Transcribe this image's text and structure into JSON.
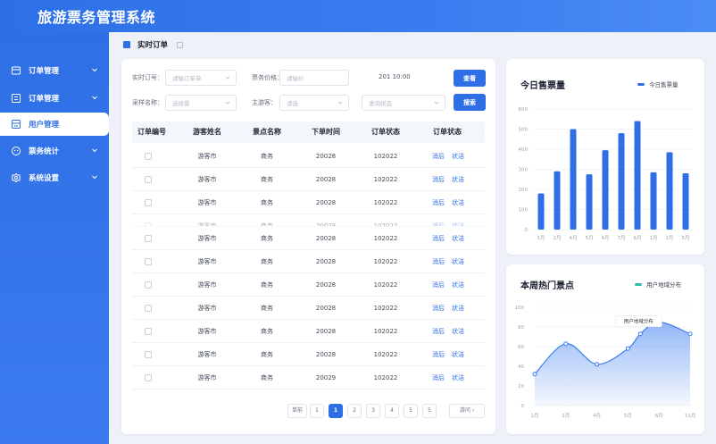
{
  "app": {
    "title": "旅游票务管理系统"
  },
  "sidebar": {
    "items": [
      {
        "label": "订单管理",
        "icon": "order-icon",
        "active": false,
        "has_arrow": true
      },
      {
        "label": "订单管理",
        "icon": "list-icon",
        "active": false,
        "has_arrow": true
      },
      {
        "label": "用户管理",
        "icon": "user-icon",
        "active": true,
        "has_arrow": false
      },
      {
        "label": "票务统计",
        "icon": "chart-icon",
        "active": false,
        "has_arrow": true
      },
      {
        "label": "系统设置",
        "icon": "gear-icon",
        "active": false,
        "has_arrow": true
      }
    ]
  },
  "page": {
    "title": "实时订单"
  },
  "filters": {
    "order_no_label": "实时订号：",
    "order_no_placeholder": "请输订单单",
    "ticket_price_label": "票务价格：",
    "ticket_price_placeholder": "请输价",
    "date_value": "201 10:00",
    "query_button": "查看",
    "scenic_label": "采样名称：",
    "scenic_placeholder": "选择景",
    "tourist_label": "主游客：",
    "tourist_placeholder": "请选",
    "status_placeholder": "查询状态",
    "search_button": "搜索"
  },
  "table": {
    "columns": [
      "订单编号",
      "游客姓名",
      "景点名称",
      "下单时间",
      "订单状态",
      "订单状态"
    ],
    "rows": [
      {
        "tourist": "游客市",
        "scenic": "商务",
        "time": "20028",
        "status": "102022",
        "faded": false
      },
      {
        "tourist": "游客市",
        "scenic": "商务",
        "time": "20028",
        "status": "102022",
        "faded": false
      },
      {
        "tourist": "游客市",
        "scenic": "商务",
        "time": "20028",
        "status": "102022",
        "faded": false
      },
      {
        "tourist": "游客市",
        "scenic": "商务",
        "time": "20028",
        "status": "102022",
        "faded": true
      },
      {
        "tourist": "游客市",
        "scenic": "商务",
        "time": "20028",
        "status": "102022",
        "faded": false
      },
      {
        "tourist": "游客市",
        "scenic": "商务",
        "time": "20028",
        "status": "102022",
        "faded": false
      },
      {
        "tourist": "游客市",
        "scenic": "商务",
        "time": "20028",
        "status": "102022",
        "faded": false
      },
      {
        "tourist": "游客市",
        "scenic": "商务",
        "time": "20028",
        "status": "102022",
        "faded": false
      },
      {
        "tourist": "游客市",
        "scenic": "商务",
        "time": "20028",
        "status": "102022",
        "faded": false
      },
      {
        "tourist": "游客市",
        "scenic": "商务",
        "time": "20028",
        "status": "102022",
        "faded": false
      },
      {
        "tourist": "游客市",
        "scenic": "商务",
        "time": "20029",
        "status": "102022",
        "faded": false
      }
    ],
    "actions": [
      "消后",
      "状洁"
    ]
  },
  "pagination": {
    "prev": "单前",
    "pages": [
      "1",
      "1",
      "2",
      "3",
      "4",
      "5",
      "5"
    ],
    "active_index": 1,
    "next": "游问"
  },
  "chart_data": [
    {
      "type": "bar",
      "title": "今日售票量",
      "legend": "今日售票量",
      "color": "#2f6fe5",
      "categories": [
        "1月",
        "2月",
        "4月",
        "5月",
        "4月",
        "7月",
        "6月",
        "1月",
        "2月",
        "5月"
      ],
      "values": [
        180,
        290,
        500,
        275,
        395,
        480,
        540,
        285,
        385,
        280
      ],
      "ylim": [
        0,
        600
      ],
      "yticks": [
        0,
        100,
        200,
        300,
        400,
        500,
        600
      ],
      "grid": true
    },
    {
      "type": "area",
      "title": "本周热门景点",
      "legend": "用户地域分布",
      "annotation": "用户地域分布",
      "color": "#3a7cf0",
      "legend_color": "#2fbfa8",
      "categories": [
        "1月",
        "2月",
        "4月",
        "5月",
        "6月",
        "11月"
      ],
      "x": [
        0,
        1,
        2,
        3,
        3.4,
        4,
        5
      ],
      "values": [
        32,
        63,
        42,
        58,
        73,
        85,
        73
      ],
      "ylim": [
        0,
        100
      ],
      "yticks": [
        0,
        20,
        40,
        60,
        80,
        100
      ],
      "grid": true
    }
  ]
}
